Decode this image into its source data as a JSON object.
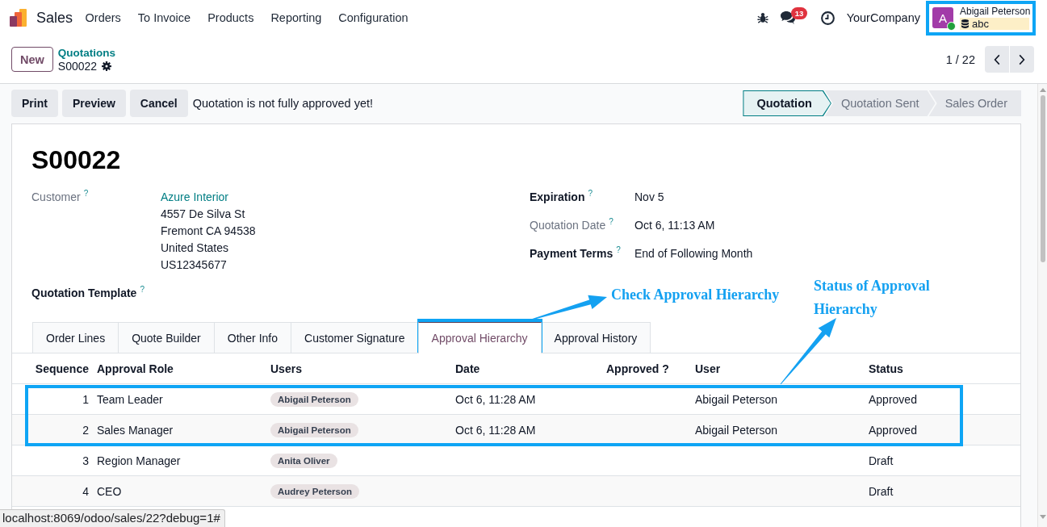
{
  "navbar": {
    "app_name": "Sales",
    "menu": [
      "Orders",
      "To Invoice",
      "Products",
      "Reporting",
      "Configuration"
    ],
    "message_count": "13",
    "company": "YourCompany",
    "user": {
      "initial": "A",
      "name": "Abigail Peterson",
      "database": "abc",
      "online": true,
      "highlighted": true
    }
  },
  "control_panel": {
    "new_button": "New",
    "breadcrumb": "Quotations",
    "record": "S00022",
    "pager": "1 / 22"
  },
  "action_bar": {
    "buttons": [
      "Print",
      "Preview",
      "Cancel"
    ],
    "message": "Quotation is not fully approved yet!",
    "stages": [
      {
        "label": "Quotation",
        "selected": true
      },
      {
        "label": "Quotation Sent",
        "selected": false
      },
      {
        "label": "Sales Order",
        "selected": false
      }
    ]
  },
  "form": {
    "title": "S00022",
    "left_fields": [
      {
        "label": "Customer",
        "help": "?",
        "readonly": true,
        "link": "Azure Interior",
        "lines": [
          "4557 De Silva St",
          "Fremont CA 94538",
          "United States",
          "US12345677"
        ]
      },
      {
        "label": "Quotation Template",
        "help": "?",
        "readonly": false
      }
    ],
    "right_fields": [
      {
        "label": "Expiration",
        "help": "?",
        "readonly": false,
        "value": "Nov 5"
      },
      {
        "label": "Quotation Date",
        "help": "?",
        "readonly": true,
        "value": "Oct 6, 11:13 AM"
      },
      {
        "label": "Payment Terms",
        "help": "?",
        "readonly": false,
        "value": "End of Following Month"
      }
    ],
    "tabs": [
      {
        "label": "Order Lines",
        "selected": false,
        "highlighted": false
      },
      {
        "label": "Quote Builder",
        "selected": false,
        "highlighted": false
      },
      {
        "label": "Other Info",
        "selected": false,
        "highlighted": false
      },
      {
        "label": "Customer Signature",
        "selected": false,
        "highlighted": false
      },
      {
        "label": "Approval Hierarchy",
        "selected": true,
        "highlighted": true
      },
      {
        "label": "Approval History",
        "selected": false,
        "highlighted": false
      }
    ],
    "table": {
      "columns": [
        "Sequence",
        "Approval Role",
        "Users",
        "Date",
        "Approved ?",
        "User",
        "Status"
      ],
      "rows": [
        {
          "sequence": "1",
          "role": "Team Leader",
          "users": [
            "Abigail Peterson"
          ],
          "date": "Oct 6, 11:28 AM",
          "user": "Abigail Peterson",
          "status": "Approved",
          "highlighted": true
        },
        {
          "sequence": "2",
          "role": "Sales Manager",
          "users": [
            "Abigail Peterson"
          ],
          "date": "Oct 6, 11:28 AM",
          "user": "Abigail Peterson",
          "status": "Approved",
          "highlighted": true
        },
        {
          "sequence": "3",
          "role": "Region Manager",
          "users": [
            "Anita Oliver"
          ],
          "status": "Draft",
          "highlighted": false
        },
        {
          "sequence": "4",
          "role": "CEO",
          "users": [
            "Audrey Peterson"
          ],
          "status": "Draft",
          "highlighted": false
        }
      ]
    }
  },
  "callouts": [
    {
      "text": "Check Approval Hierarchy"
    },
    {
      "text": "Status of Approval Hierarchy"
    }
  ],
  "browser_status": {
    "url": "localhost:8069/odoo/sales/22?debug=1#"
  }
}
